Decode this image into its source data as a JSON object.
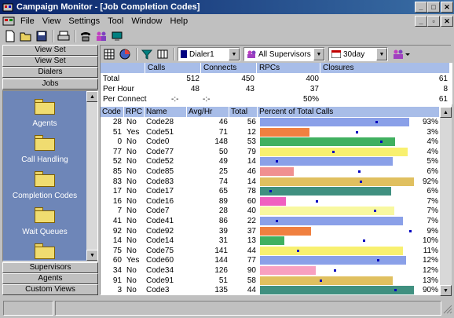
{
  "window": {
    "title": "Campaign Monitor - [Job Completion Codes]"
  },
  "menu": [
    "File",
    "View",
    "Settings",
    "Tool",
    "Window",
    "Help"
  ],
  "sidebar": {
    "top_buttons": [
      "View Set",
      "View Set",
      "Dialers",
      "Jobs"
    ],
    "items": [
      "Agents",
      "Call Handling",
      "Completion Codes",
      "Wait Queues"
    ],
    "bottom_buttons": [
      "Supervisors",
      "Agents",
      "Custom Views"
    ]
  },
  "filters": {
    "dialer": "Dialer1",
    "supervisor": "All Supervisors",
    "period": "30day"
  },
  "summary": {
    "headers": [
      "Calls",
      "Connects",
      "RPCs",
      "Closures"
    ],
    "rows": [
      {
        "label": "Total",
        "calls": "512",
        "connects": "450",
        "rpcs": "400",
        "closures": "61"
      },
      {
        "label": "Per Hour",
        "calls": "48",
        "connects": "43",
        "rpcs": "37",
        "closures": "8"
      },
      {
        "label": "Per Connect",
        "calls": "-:-",
        "connects": "-:-",
        "rpcs": "50%",
        "closures": "61"
      }
    ]
  },
  "grid": {
    "headers": [
      "Code",
      "RPC",
      "Name",
      "Avg/Hr",
      "Total",
      "Percent of Total Calls"
    ],
    "colors": {
      "blue": "#8aa0e8",
      "orange": "#f08040",
      "green": "#40b060",
      "yellow": "#f8f070",
      "pink": "#f09090",
      "gold": "#e0c060",
      "teal": "#409080",
      "magenta": "#f060c0",
      "lightyellow": "#f8f8a0",
      "pinkl": "#f8a0c0"
    },
    "rows": [
      {
        "code": "28",
        "rpc": "No",
        "name": "Code28",
        "avg": "46",
        "total": "56",
        "pct": "93%",
        "color": "blue",
        "fill": 0.97,
        "marker": 0.75
      },
      {
        "code": "51",
        "rpc": "Yes",
        "name": "Code51",
        "avg": "71",
        "total": "12",
        "pct": "3%",
        "color": "orange",
        "fill": 0.32,
        "marker": 0.62
      },
      {
        "code": "0",
        "rpc": "No",
        "name": "Code0",
        "avg": "148",
        "total": "53",
        "pct": "4%",
        "color": "green",
        "fill": 0.88,
        "marker": 0.78
      },
      {
        "code": "77",
        "rpc": "No",
        "name": "Code77",
        "avg": "50",
        "total": "79",
        "pct": "4%",
        "color": "yellow",
        "fill": 0.96,
        "marker": 0.47
      },
      {
        "code": "52",
        "rpc": "No",
        "name": "Code52",
        "avg": "49",
        "total": "14",
        "pct": "5%",
        "color": "blue",
        "fill": 0.86,
        "marker": 0.1
      },
      {
        "code": "85",
        "rpc": "No",
        "name": "Code85",
        "avg": "25",
        "total": "46",
        "pct": "6%",
        "color": "pink",
        "fill": 0.22,
        "marker": 0.64
      },
      {
        "code": "83",
        "rpc": "No",
        "name": "Code83",
        "avg": "74",
        "total": "14",
        "pct": "92%",
        "color": "gold",
        "fill": 1.0,
        "marker": 0.65
      },
      {
        "code": "17",
        "rpc": "No",
        "name": "Code17",
        "avg": "65",
        "total": "78",
        "pct": "6%",
        "color": "teal",
        "fill": 0.85,
        "marker": 0.06
      },
      {
        "code": "16",
        "rpc": "No",
        "name": "Code16",
        "avg": "89",
        "total": "60",
        "pct": "7%",
        "color": "magenta",
        "fill": 0.17,
        "marker": 0.36
      },
      {
        "code": "7",
        "rpc": "No",
        "name": "Code7",
        "avg": "28",
        "total": "40",
        "pct": "7%",
        "color": "lightyellow",
        "fill": 0.87,
        "marker": 0.74
      },
      {
        "code": "41",
        "rpc": "No",
        "name": "Code41",
        "avg": "86",
        "total": "22",
        "pct": "7%",
        "color": "blue",
        "fill": 0.93,
        "marker": 0.1
      },
      {
        "code": "92",
        "rpc": "No",
        "name": "Code92",
        "avg": "39",
        "total": "37",
        "pct": "9%",
        "color": "orange",
        "fill": 0.33,
        "marker": 0.97
      },
      {
        "code": "14",
        "rpc": "No",
        "name": "Code14",
        "avg": "31",
        "total": "13",
        "pct": "10%",
        "color": "green",
        "fill": 0.16,
        "marker": 0.67
      },
      {
        "code": "75",
        "rpc": "No",
        "name": "Code75",
        "avg": "141",
        "total": "44",
        "pct": "11%",
        "color": "yellow",
        "fill": 0.93,
        "marker": 0.24
      },
      {
        "code": "60",
        "rpc": "Yes",
        "name": "Code60",
        "avg": "144",
        "total": "77",
        "pct": "12%",
        "color": "blue",
        "fill": 0.95,
        "marker": 0.76
      },
      {
        "code": "34",
        "rpc": "No",
        "name": "Code34",
        "avg": "126",
        "total": "90",
        "pct": "12%",
        "color": "pinkl",
        "fill": 0.36,
        "marker": 0.48
      },
      {
        "code": "91",
        "rpc": "No",
        "name": "Code91",
        "avg": "51",
        "total": "58",
        "pct": "13%",
        "color": "gold",
        "fill": 0.86,
        "marker": 0.39
      },
      {
        "code": "3",
        "rpc": "No",
        "name": "Code3",
        "avg": "135",
        "total": "44",
        "pct": "90%",
        "color": "teal",
        "fill": 1.0,
        "marker": 0.87
      }
    ]
  }
}
